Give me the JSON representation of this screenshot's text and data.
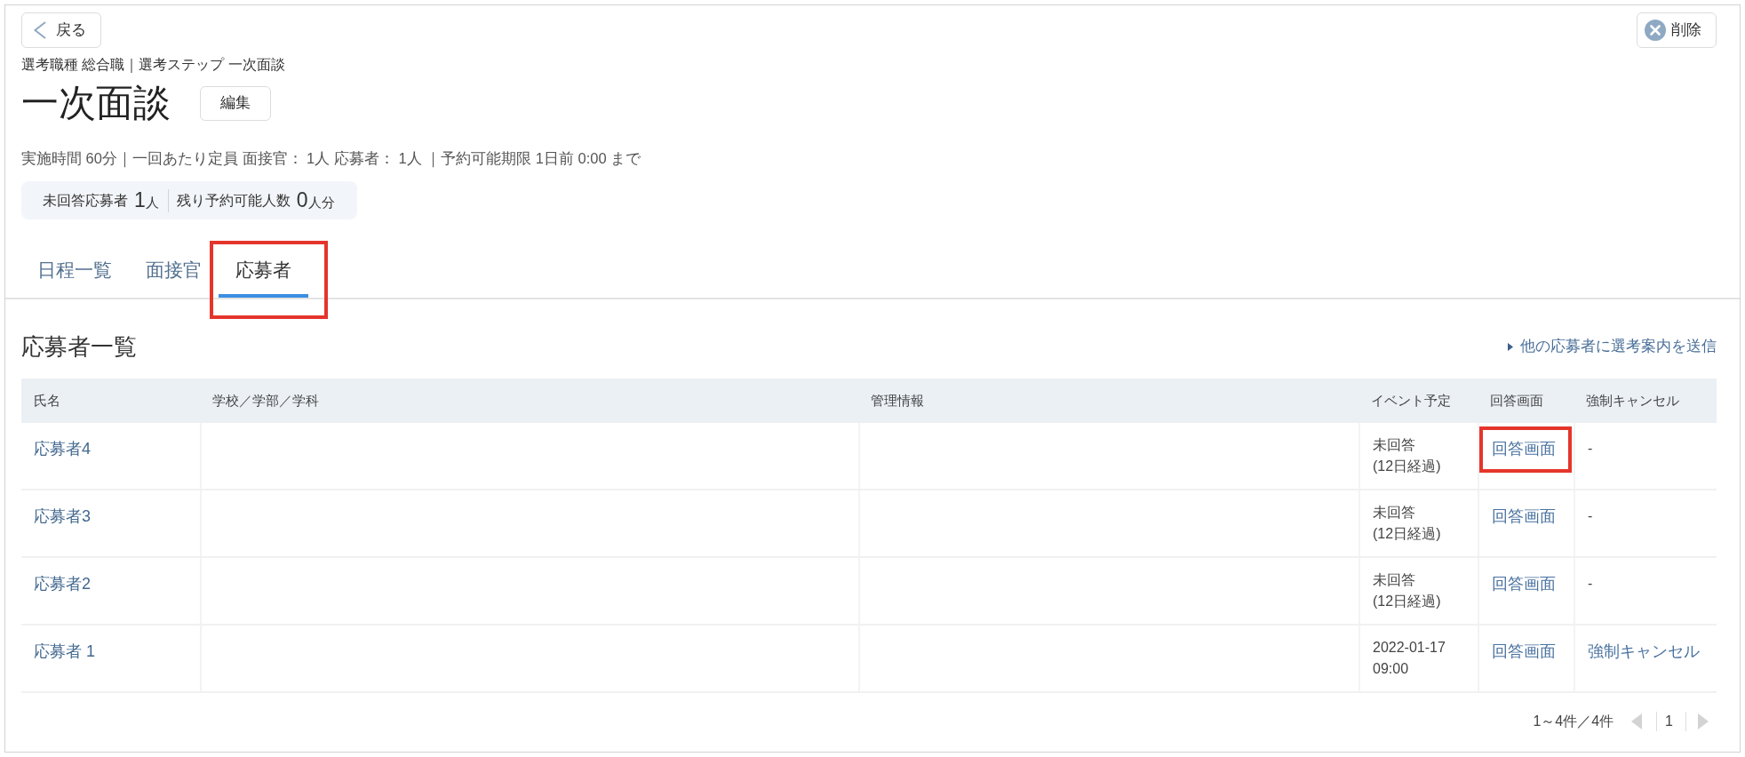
{
  "header": {
    "back_button": "戻る",
    "delete_button": "削除",
    "breadcrumb": "選考職種 総合職｜選考ステップ 一次面談",
    "title": "一次面談",
    "edit_button": "編集",
    "details": "実施時間 60分｜一回あたり定員 面接官： 1人 応募者： 1人 ｜予約可能期限 1日前 0:00 まで"
  },
  "stats": [
    {
      "label": "未回答応募者",
      "value": "1",
      "unit": "人"
    },
    {
      "label": "残り予約可能人数",
      "value": "0",
      "unit": "人分"
    }
  ],
  "tabs": [
    {
      "label": "日程一覧",
      "selected": false,
      "highlighted": false
    },
    {
      "label": "面接官",
      "selected": false,
      "highlighted": false
    },
    {
      "label": "応募者",
      "selected": true,
      "highlighted": true
    }
  ],
  "section": {
    "title": "応募者一覧",
    "send_link": "他の応募者に選考案内を送信"
  },
  "table": {
    "columns": [
      "氏名",
      "学校／学部／学科",
      "管理情報",
      "イベント予定",
      "回答画面",
      "強制キャンセル"
    ],
    "rows": [
      {
        "name": "応募者4",
        "event": [
          "未回答",
          "(12日経過)"
        ],
        "answer": {
          "label": "回答画面",
          "highlighted": true
        },
        "cancel": {
          "kind": "text",
          "label": "-"
        }
      },
      {
        "name": "応募者3",
        "event": [
          "未回答",
          "(12日経過)"
        ],
        "answer": {
          "label": "回答画面",
          "highlighted": false
        },
        "cancel": {
          "kind": "text",
          "label": "-"
        }
      },
      {
        "name": "応募者2",
        "event": [
          "未回答",
          "(12日経過)"
        ],
        "answer": {
          "label": "回答画面",
          "highlighted": false
        },
        "cancel": {
          "kind": "text",
          "label": "-"
        }
      },
      {
        "name": "応募者 1",
        "event": [
          "2022-01-17",
          "09:00"
        ],
        "answer": {
          "label": "回答画面",
          "highlighted": false
        },
        "cancel": {
          "kind": "link",
          "label": "強制キャンセル"
        }
      }
    ]
  },
  "pagination": {
    "summary": "1～4件／4件",
    "prev_disabled": true,
    "pages": [
      {
        "label": "1",
        "selected": true
      }
    ],
    "next_disabled": true
  }
}
